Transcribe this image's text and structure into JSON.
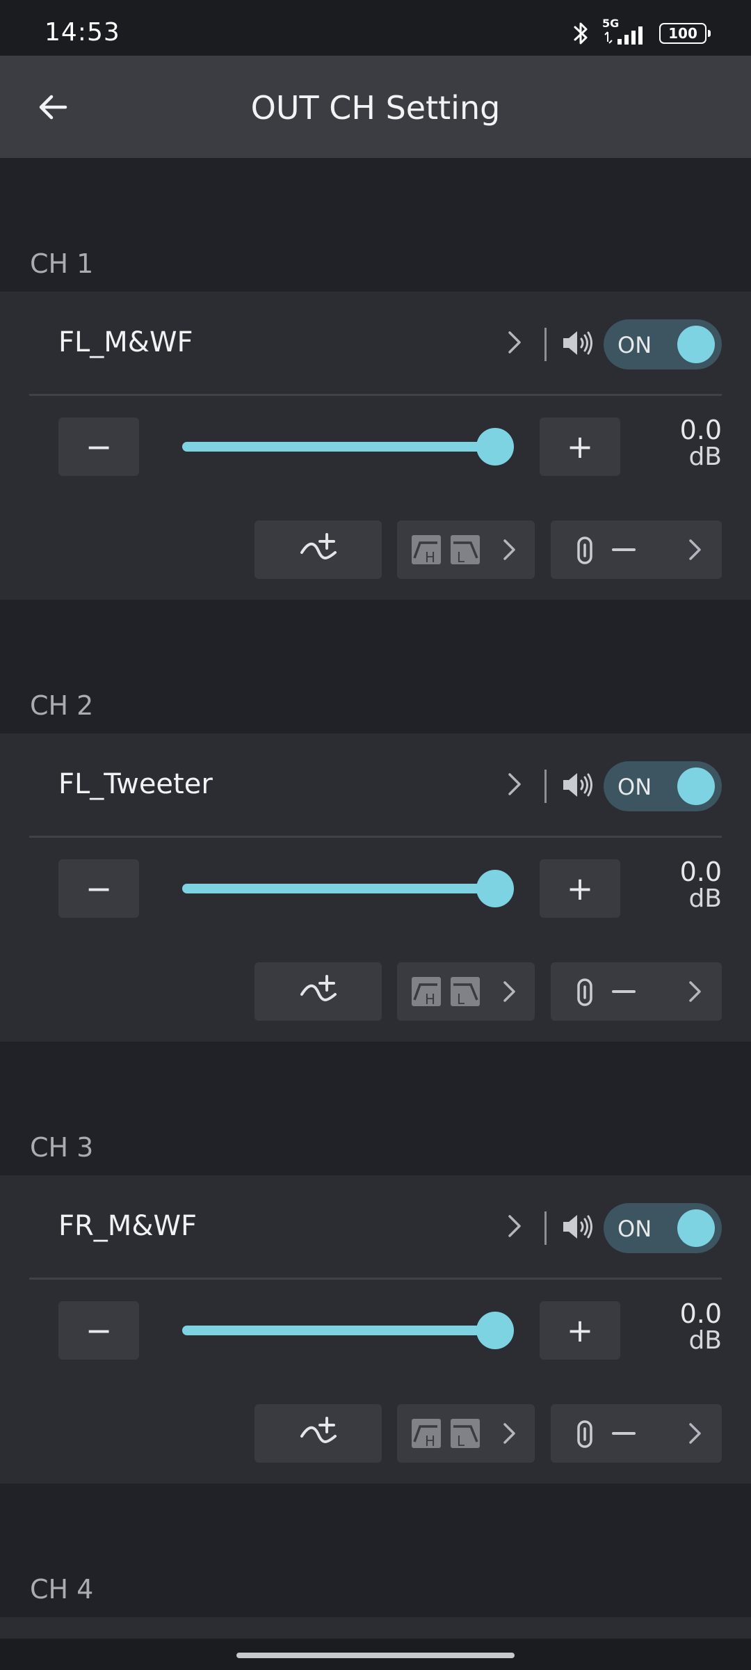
{
  "status_bar": {
    "time": "14:53",
    "network": "5G",
    "battery": "100",
    "icons": [
      "bluetooth-icon",
      "signal-icon",
      "battery-icon"
    ]
  },
  "header": {
    "title": "OUT CH Setting",
    "back_icon": "arrow-left-icon"
  },
  "colors": {
    "accent": "#7dd3e2",
    "card": "#2b2d33",
    "background": "#202227",
    "header": "#3b3d42",
    "toggle_track": "#3c5560"
  },
  "controls": {
    "minus": "−",
    "plus": "+",
    "db_unit": "dB"
  },
  "channels": [
    {
      "label": "CH 1",
      "name": "FL_M&WF",
      "toggle": "ON",
      "gain_db": "0.0",
      "gain_level": 1.0
    },
    {
      "label": "CH 2",
      "name": "FL_Tweeter",
      "toggle": "ON",
      "gain_db": "0.0",
      "gain_level": 1.0
    },
    {
      "label": "CH 3",
      "name": "FR_M&WF",
      "toggle": "ON",
      "gain_db": "0.0",
      "gain_level": 1.0
    },
    {
      "label": "CH 4"
    }
  ]
}
